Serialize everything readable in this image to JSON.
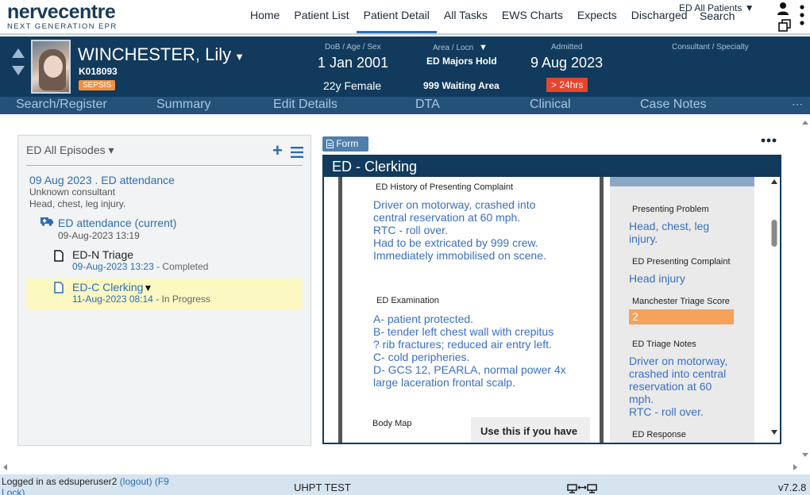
{
  "app": {
    "logo_main": "nervecentre",
    "logo_sub": "NEXT GENERATION EPR"
  },
  "nav": {
    "items": [
      {
        "label": "Home"
      },
      {
        "label": "Patient List"
      },
      {
        "label": "Patient Detail"
      },
      {
        "label": "All Tasks"
      },
      {
        "label": "EWS Charts"
      },
      {
        "label": "Expects"
      },
      {
        "label": "Discharged"
      }
    ],
    "active_label": "Patient Detail",
    "filter_label": "ED All Patients ▼",
    "search_label": "Search"
  },
  "patient": {
    "name": "WINCHESTER, Lily",
    "name_caret": "▼",
    "mrn": "K018093",
    "alert": "SEPSIS",
    "dob_label": "DoB / Age / Sex",
    "dob": "1 Jan 2001",
    "age_sex": "22y Female",
    "area_label": "Area / Locn",
    "area_caret": "▼",
    "area": "ED Majors Hold",
    "location": "999 Waiting Area",
    "admitted_label": "Admitted",
    "admitted": "9 Aug 2023",
    "los_badge": "> 24hrs",
    "consultant_label": "Consultant / Specialty"
  },
  "tabs": {
    "items": [
      {
        "label": "Search/Register"
      },
      {
        "label": "Summary"
      },
      {
        "label": "Edit Details"
      },
      {
        "label": "DTA"
      },
      {
        "label": "Clinical"
      },
      {
        "label": "Case Notes"
      }
    ],
    "more": "⋯"
  },
  "episodes": {
    "title": "ED All Episodes ▾",
    "add": "+",
    "date_line": "09 Aug 2023 . ED attendance",
    "consultant": "Unknown consultant",
    "condition": "Head, chest, leg injury.",
    "attendance_label": "ED attendance (current)",
    "attendance_time": "09-Aug-2023 13:19",
    "triage_label": "ED-N Triage",
    "triage_time": "09-Aug-2023 13:23",
    "triage_status": " - Completed",
    "clerking_label": "ED-C Clerking",
    "clerking_caret": "▼",
    "clerking_time": "11-Aug-2023 08:14",
    "clerking_status": " - In Progress"
  },
  "form": {
    "button_label": "Form",
    "title": "ED - Clerking",
    "hpc_label": "ED History of Presenting Complaint",
    "hpc_lines": [
      "Driver on motorway, crashed into",
      "central reservation at 60 mph.",
      "RTC - roll over.",
      "Had to be extricated by 999 crew.",
      "Immediately immobilised on scene."
    ],
    "exam_label": "ED Examination",
    "exam_lines": [
      "A- patient protected.",
      "B- tender left chest wall with crepitus",
      "? rib fractures; reduced air entry left.",
      "C- cold peripheries.",
      "D- GCS 12, PEARLA, normal power 4x",
      "large laceration frontal scalp."
    ],
    "bodymap_label": "Body Map",
    "use_this": "Use this if you have",
    "presenting_problem_label": "Presenting Problem",
    "presenting_problem_lines": [
      "Head, chest, leg",
      "injury."
    ],
    "presenting_complaint_label": "ED Presenting Complaint",
    "presenting_complaint": "Head injury",
    "mts_label": "Manchester Triage Score",
    "mts_value": "2",
    "triage_notes_label": "ED Triage Notes",
    "triage_notes_lines": [
      "Driver on motorway,",
      "crashed into central",
      "reservation at 60",
      "mph.",
      "RTC - roll over."
    ],
    "response_label": "ED Response"
  },
  "status": {
    "login_text": "Logged in as edsuperuser2",
    "logout": "(logout)",
    "lock": "(F9 Lock)",
    "environment": "UHPT TEST",
    "version": "v7.2.8"
  },
  "colors": {
    "banner": "#113a5c",
    "tabs": "#245178",
    "link": "#2b6db3",
    "sepsis": "#f0903f",
    "los": "#e8442c",
    "highlight": "#fbf8c2"
  }
}
